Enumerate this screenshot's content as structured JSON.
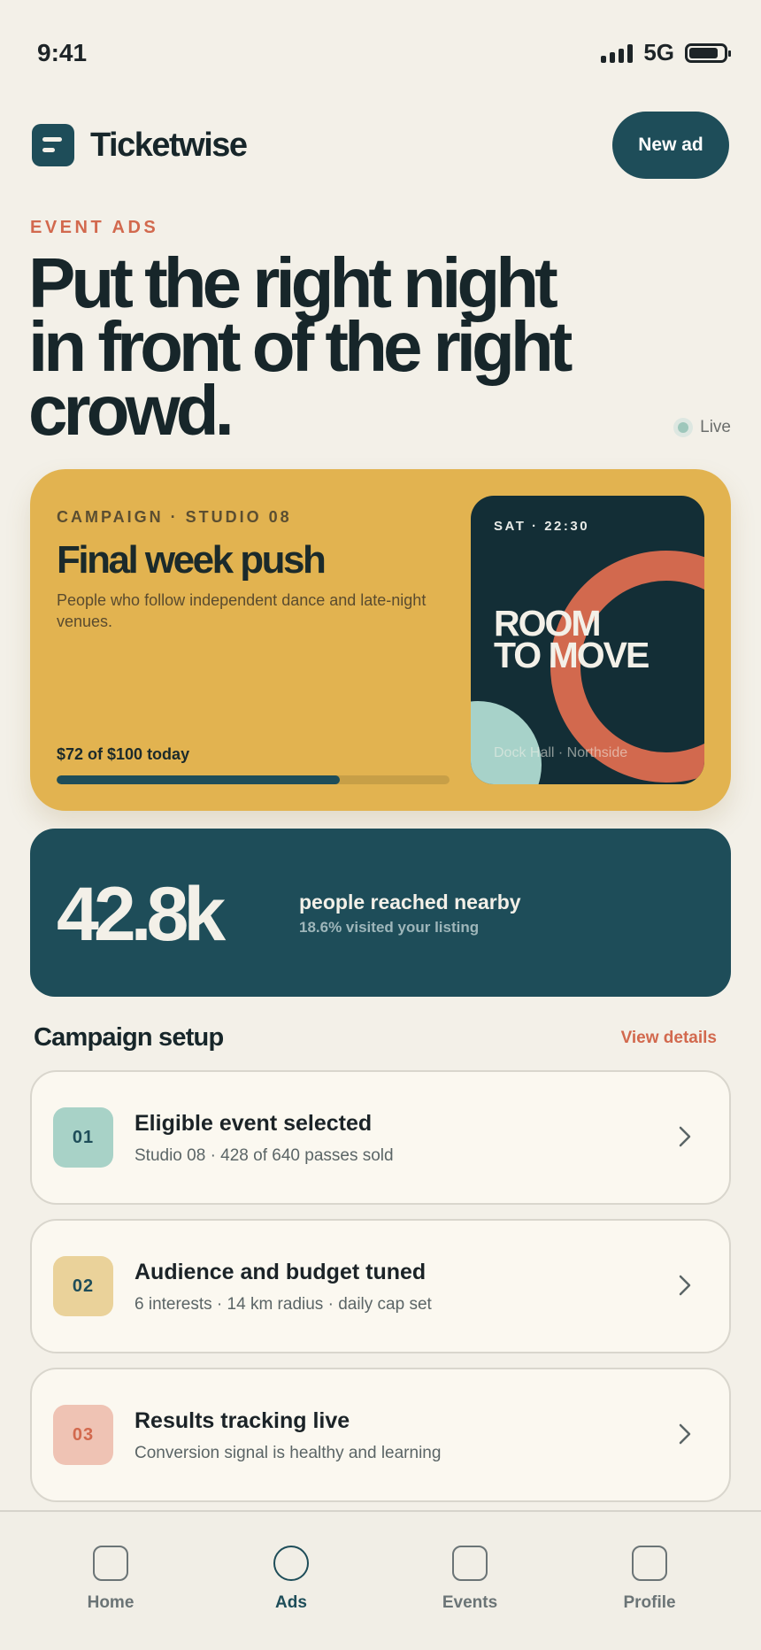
{
  "status_bar": {
    "time": "9:41",
    "network": "5G",
    "battery_level": 0.85
  },
  "header": {
    "brand": "Ticketwise",
    "new_ad_label": "New ad"
  },
  "hero": {
    "eyebrow": "EVENT ADS",
    "headline_lines": [
      "Put the right night",
      "in front of the right",
      "crowd."
    ],
    "live_label": "Live"
  },
  "campaign": {
    "eyebrow": "CAMPAIGN · STUDIO 08",
    "title": "Final week push",
    "description": "People who follow independent dance and late-night venues.",
    "budget_text": "$72 of $100 today",
    "spent": 72,
    "budget": 100,
    "poster": {
      "time": "SAT · 22:30",
      "title_lines": [
        "ROOM",
        "TO MOVE"
      ],
      "venue": "Dock Hall · Northside"
    }
  },
  "reach": {
    "value": "42.8k",
    "label": "people reached nearby",
    "sub": "18.6% visited your listing"
  },
  "setup": {
    "title": "Campaign setup",
    "view_details": "View details",
    "steps": [
      {
        "num": "01",
        "title": "Eligible event selected",
        "subtitle": "Studio 08 · 428 of 640 passes sold",
        "badge_bg": "#a8d2c7",
        "badge_fg": "#1e4d59"
      },
      {
        "num": "02",
        "title": "Audience and budget tuned",
        "subtitle": "6 interests · 14 km radius · daily cap set",
        "badge_bg": "#ead29a",
        "badge_fg": "#1e4d59"
      },
      {
        "num": "03",
        "title": "Results tracking live",
        "subtitle": "Conversion signal is healthy and learning",
        "badge_bg": "#efc3b4",
        "badge_fg": "#d2694e"
      }
    ]
  },
  "nav": {
    "items": [
      {
        "label": "Home",
        "icon": "home-icon",
        "shape": "rounded-square",
        "active": false
      },
      {
        "label": "Ads",
        "icon": "ads-icon",
        "shape": "circle",
        "active": true
      },
      {
        "label": "Events",
        "icon": "events-icon",
        "shape": "rounded-square",
        "active": false
      },
      {
        "label": "Profile",
        "icon": "profile-icon",
        "shape": "rounded-square",
        "active": false
      }
    ]
  },
  "colors": {
    "background": "#f3f0e8",
    "primary": "#1e4d59",
    "accent": "#d2694e",
    "campaign_card": "#e2b350",
    "poster_bg": "#132e36"
  }
}
